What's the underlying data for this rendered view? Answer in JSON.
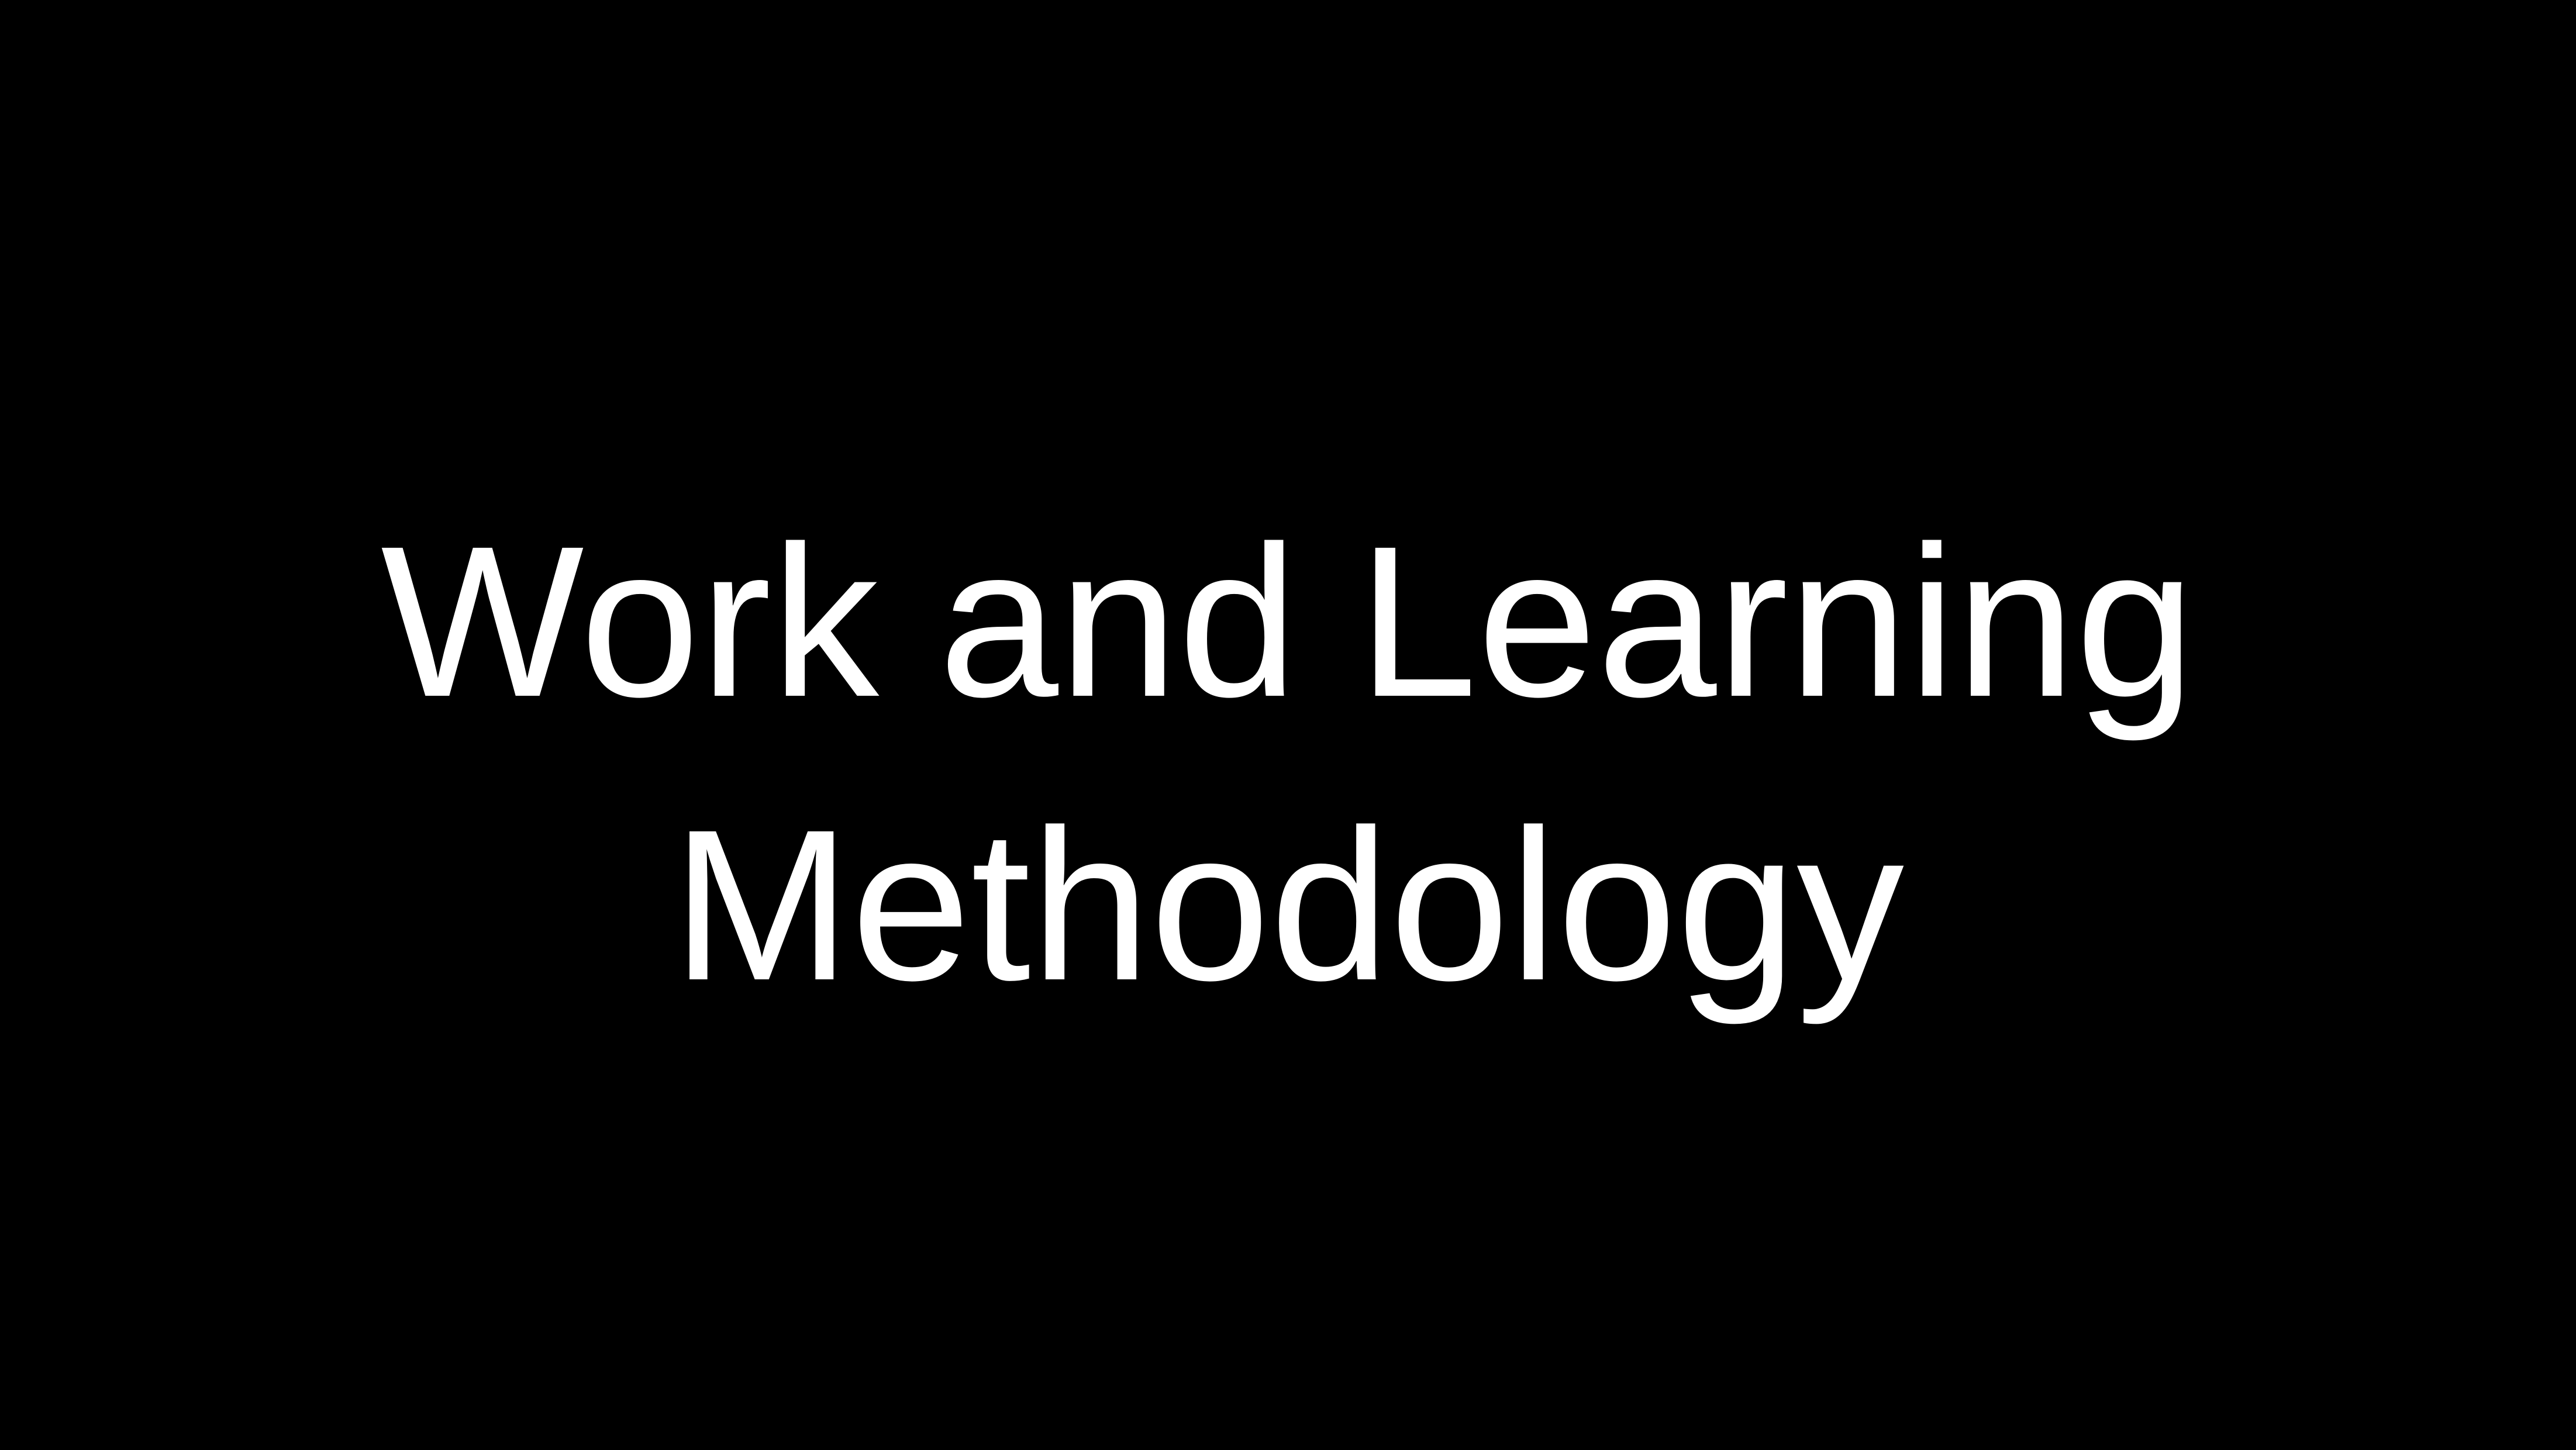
{
  "slide": {
    "title_line_1": "Work and Learning",
    "title_line_2": "Methodology"
  },
  "colors": {
    "background": "#000000",
    "text": "#ffffff"
  }
}
